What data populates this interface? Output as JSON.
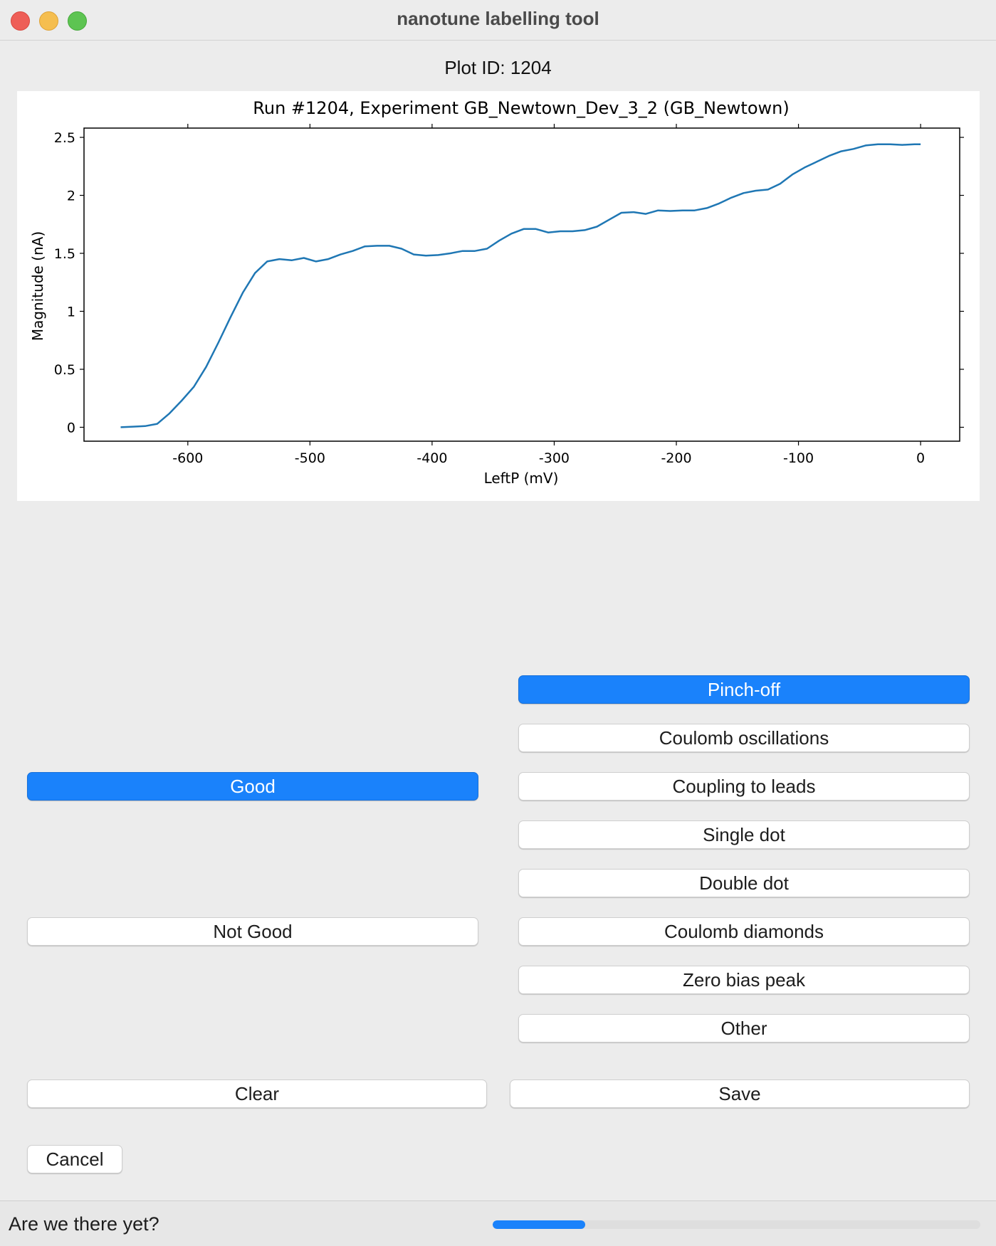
{
  "window": {
    "title": "nanotune labelling tool"
  },
  "plot_id_label": "Plot ID: 1204",
  "chart_data": {
    "type": "line",
    "title": "Run #1204, Experiment GB_Newtown_Dev_3_2 (GB_Newtown)",
    "xlabel": "LeftP (mV)",
    "ylabel": "Magnitude (nA)",
    "xlim": [
      -685,
      32
    ],
    "ylim": [
      -0.12,
      2.58
    ],
    "xticks": [
      -600,
      -500,
      -400,
      -300,
      -200,
      -100,
      0
    ],
    "xtick_labels": [
      "-600",
      "-500",
      "-400",
      "-300",
      "-200",
      "-100",
      "0"
    ],
    "yticks": [
      0,
      0.5,
      1,
      1.5,
      2,
      2.5
    ],
    "ytick_labels": [
      "0",
      "0.5",
      "1",
      "1.5",
      "2",
      "2.5"
    ],
    "color": "#1f77b4",
    "grid": false,
    "x": [
      -655,
      -645,
      -635,
      -625,
      -615,
      -605,
      -595,
      -585,
      -575,
      -565,
      -555,
      -545,
      -535,
      -525,
      -515,
      -505,
      -495,
      -485,
      -475,
      -465,
      -455,
      -445,
      -435,
      -425,
      -415,
      -405,
      -395,
      -385,
      -375,
      -365,
      -355,
      -345,
      -335,
      -325,
      -315,
      -305,
      -295,
      -285,
      -275,
      -265,
      -255,
      -245,
      -235,
      -225,
      -215,
      -205,
      -195,
      -185,
      -175,
      -165,
      -155,
      -145,
      -135,
      -125,
      -115,
      -105,
      -95,
      -85,
      -75,
      -65,
      -55,
      -45,
      -35,
      -25,
      -15,
      -5,
      0
    ],
    "y": [
      0.0,
      0.005,
      0.01,
      0.03,
      0.12,
      0.23,
      0.35,
      0.52,
      0.73,
      0.95,
      1.16,
      1.33,
      1.43,
      1.45,
      1.44,
      1.46,
      1.43,
      1.45,
      1.49,
      1.52,
      1.56,
      1.565,
      1.565,
      1.54,
      1.49,
      1.48,
      1.485,
      1.5,
      1.52,
      1.52,
      1.54,
      1.61,
      1.67,
      1.71,
      1.71,
      1.68,
      1.69,
      1.69,
      1.7,
      1.73,
      1.79,
      1.85,
      1.855,
      1.84,
      1.87,
      1.865,
      1.87,
      1.87,
      1.89,
      1.93,
      1.98,
      2.02,
      2.04,
      2.05,
      2.1,
      2.18,
      2.24,
      2.29,
      2.34,
      2.38,
      2.4,
      2.43,
      2.44,
      2.44,
      2.435,
      2.44,
      2.44
    ]
  },
  "left_labels": {
    "good": "Good",
    "not_good": "Not Good"
  },
  "right_labels": [
    "Pinch-off",
    "Coulomb oscillations",
    "Coupling to leads",
    "Single dot",
    "Double dot",
    "Coulomb diamonds",
    "Zero bias peak",
    "Other"
  ],
  "actions": {
    "clear": "Clear",
    "save": "Save",
    "cancel": "Cancel"
  },
  "status": {
    "text": "Are we there yet?",
    "progress": 0.19
  }
}
